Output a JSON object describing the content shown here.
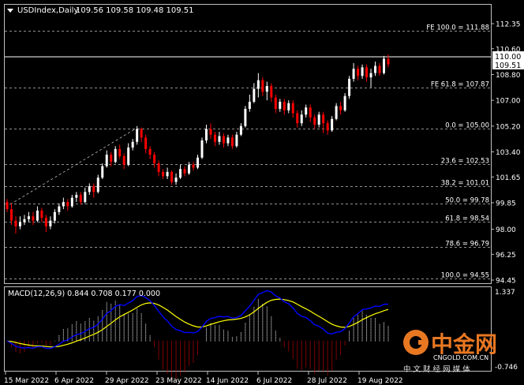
{
  "header": {
    "symbol_label": "USDIndex,Daily",
    "ohlc": "109.56 109.58 109.48 109.51"
  },
  "macd_label": "MACD(12,26,9) 0.844 0.708 0.177 0.000",
  "macd_axis": {
    "top": "1.337",
    "bottom": "-0.746"
  },
  "price_axis": {
    "ticks": [
      "112.35",
      "110.60",
      "108.80",
      "107.00",
      "105.20",
      "103.40",
      "101.65",
      "99.85",
      "98.00",
      "96.25",
      "94.45"
    ],
    "current_price": "110.00",
    "current_price_b": "109.51"
  },
  "fib_levels": [
    {
      "label": "FE 100.0 = 111.88",
      "value": 111.88,
      "kind": "fe"
    },
    {
      "label": "FE 61.8 = 107.87",
      "value": 107.87,
      "kind": "fe"
    },
    {
      "label": "0.0 = 105.00",
      "value": 105.0,
      "kind": "retr"
    },
    {
      "label": "23.6 = 102.53",
      "value": 102.53,
      "kind": "retr"
    },
    {
      "label": "38.2 = 101.01",
      "value": 101.01,
      "kind": "retr"
    },
    {
      "label": "50.0 = 99.78",
      "value": 99.78,
      "kind": "retr"
    },
    {
      "label": "61.8 = 98.54",
      "value": 98.54,
      "kind": "retr"
    },
    {
      "label": "78.6 = 96.79",
      "value": 96.79,
      "kind": "retr"
    },
    {
      "label": "100.0 = 94.55",
      "value": 94.55,
      "kind": "retr"
    }
  ],
  "time_axis": [
    "15 Mar 2022",
    "6 Apr 2022",
    "29 Apr 2022",
    "23 May 2022",
    "14 Jun 2022",
    "6 Jul 2022",
    "28 Jul 2022",
    "19 Aug 2022"
  ],
  "watermark": {
    "brand": "中金网",
    "url": "CNGOLD.COM.CN",
    "tagline": "中 文 财 经 网 媒 体"
  },
  "colors": {
    "bull": "#ffffff",
    "bear": "#ff0000",
    "grid": "#c0c0c0",
    "macd_signal": "#ffff00",
    "macd_line": "#0000ff"
  },
  "chart_data": {
    "type": "candlestick",
    "ylim": [
      94.45,
      112.35
    ],
    "candles": [
      [
        99.9,
        99.4,
        100.1,
        99.2
      ],
      [
        99.4,
        98.6,
        99.8,
        98.3
      ],
      [
        98.6,
        98.2,
        98.9,
        97.7
      ],
      [
        98.2,
        98.5,
        98.9,
        98.0
      ],
      [
        98.5,
        98.7,
        99.0,
        98.3
      ],
      [
        98.7,
        98.9,
        99.2,
        98.5
      ],
      [
        98.9,
        98.6,
        99.2,
        98.3
      ],
      [
        98.6,
        99.3,
        99.6,
        98.5
      ],
      [
        99.3,
        98.8,
        99.5,
        98.5
      ],
      [
        98.8,
        98.2,
        99.0,
        97.8
      ],
      [
        98.2,
        98.6,
        98.9,
        98.0
      ],
      [
        98.6,
        99.2,
        99.4,
        98.4
      ],
      [
        99.2,
        99.6,
        99.8,
        99.0
      ],
      [
        99.6,
        99.9,
        100.2,
        99.4
      ],
      [
        99.9,
        99.6,
        100.1,
        99.3
      ],
      [
        99.6,
        100.2,
        100.4,
        99.5
      ],
      [
        100.2,
        100.4,
        100.6,
        99.9
      ],
      [
        100.4,
        99.9,
        100.6,
        99.7
      ],
      [
        99.9,
        100.6,
        100.9,
        99.8
      ],
      [
        100.6,
        101.0,
        101.2,
        100.4
      ],
      [
        101.0,
        100.6,
        101.2,
        100.2
      ],
      [
        100.6,
        101.6,
        101.8,
        100.5
      ],
      [
        101.6,
        102.4,
        102.6,
        101.5
      ],
      [
        102.4,
        103.2,
        103.5,
        102.3
      ],
      [
        103.2,
        102.7,
        103.4,
        102.4
      ],
      [
        102.7,
        103.6,
        103.8,
        102.6
      ],
      [
        103.6,
        103.1,
        103.9,
        102.9
      ],
      [
        103.1,
        102.5,
        103.3,
        102.2
      ],
      [
        102.5,
        103.7,
        104.0,
        102.4
      ],
      [
        103.7,
        104.1,
        104.3,
        103.5
      ],
      [
        104.1,
        105.0,
        105.2,
        103.9
      ],
      [
        105.0,
        104.4,
        105.1,
        104.1
      ],
      [
        104.4,
        103.6,
        104.6,
        103.3
      ],
      [
        103.6,
        103.2,
        103.8,
        102.9
      ],
      [
        103.2,
        102.6,
        103.4,
        102.3
      ],
      [
        102.6,
        102.0,
        102.8,
        101.7
      ],
      [
        102.0,
        101.7,
        102.2,
        101.5
      ],
      [
        101.7,
        102.0,
        102.3,
        101.5
      ],
      [
        102.0,
        101.3,
        102.1,
        101.1
      ],
      [
        101.3,
        101.6,
        101.9,
        101.1
      ],
      [
        101.6,
        102.2,
        102.5,
        101.5
      ],
      [
        102.2,
        101.9,
        102.4,
        101.7
      ],
      [
        101.9,
        102.5,
        102.7,
        101.8
      ],
      [
        102.5,
        102.3,
        102.7,
        102.1
      ],
      [
        102.3,
        103.0,
        103.2,
        102.2
      ],
      [
        103.0,
        104.2,
        104.4,
        102.9
      ],
      [
        104.2,
        105.0,
        105.3,
        104.0
      ],
      [
        105.0,
        104.6,
        105.4,
        104.3
      ],
      [
        104.6,
        104.1,
        104.8,
        103.8
      ],
      [
        104.1,
        104.5,
        104.8,
        103.9
      ],
      [
        104.5,
        104.0,
        104.7,
        103.7
      ],
      [
        104.0,
        104.4,
        104.6,
        103.8
      ],
      [
        104.4,
        103.8,
        104.6,
        103.6
      ],
      [
        103.8,
        104.6,
        104.8,
        103.7
      ],
      [
        104.6,
        105.2,
        105.4,
        104.5
      ],
      [
        105.2,
        106.4,
        106.6,
        105.1
      ],
      [
        106.4,
        106.9,
        107.4,
        106.2
      ],
      [
        106.9,
        107.8,
        108.2,
        106.8
      ],
      [
        107.8,
        108.4,
        108.9,
        107.2
      ],
      [
        108.4,
        107.6,
        108.6,
        107.3
      ],
      [
        107.6,
        108.0,
        108.3,
        107.0
      ],
      [
        108.0,
        107.2,
        108.2,
        106.9
      ],
      [
        107.2,
        106.4,
        107.4,
        106.1
      ],
      [
        106.4,
        106.9,
        107.1,
        106.2
      ],
      [
        106.9,
        106.3,
        107.1,
        106.0
      ],
      [
        106.3,
        106.8,
        107.0,
        106.1
      ],
      [
        106.8,
        106.1,
        107.0,
        105.8
      ],
      [
        106.1,
        105.4,
        106.3,
        105.1
      ],
      [
        105.4,
        106.0,
        106.3,
        105.2
      ],
      [
        106.0,
        106.5,
        106.7,
        105.8
      ],
      [
        106.5,
        105.8,
        106.7,
        105.5
      ],
      [
        105.8,
        105.3,
        106.0,
        105.0
      ],
      [
        105.3,
        106.0,
        106.2,
        105.1
      ],
      [
        106.0,
        105.4,
        106.2,
        104.7
      ],
      [
        105.4,
        104.9,
        105.6,
        104.6
      ],
      [
        104.9,
        105.7,
        105.9,
        104.8
      ],
      [
        105.7,
        106.6,
        106.8,
        105.6
      ],
      [
        106.6,
        106.3,
        106.9,
        106.0
      ],
      [
        106.3,
        107.3,
        107.5,
        106.2
      ],
      [
        107.3,
        108.5,
        108.7,
        107.1
      ],
      [
        108.5,
        109.2,
        109.6,
        108.3
      ],
      [
        109.2,
        108.7,
        109.4,
        108.4
      ],
      [
        108.7,
        109.3,
        109.5,
        108.5
      ],
      [
        109.3,
        108.6,
        109.5,
        108.3
      ],
      [
        108.6,
        108.9,
        109.2,
        107.9
      ],
      [
        108.9,
        109.4,
        109.7,
        108.7
      ],
      [
        109.4,
        108.9,
        109.6,
        108.7
      ],
      [
        108.9,
        109.9,
        110.1,
        108.8
      ],
      [
        109.9,
        109.51,
        110.2,
        109.3
      ]
    ]
  }
}
